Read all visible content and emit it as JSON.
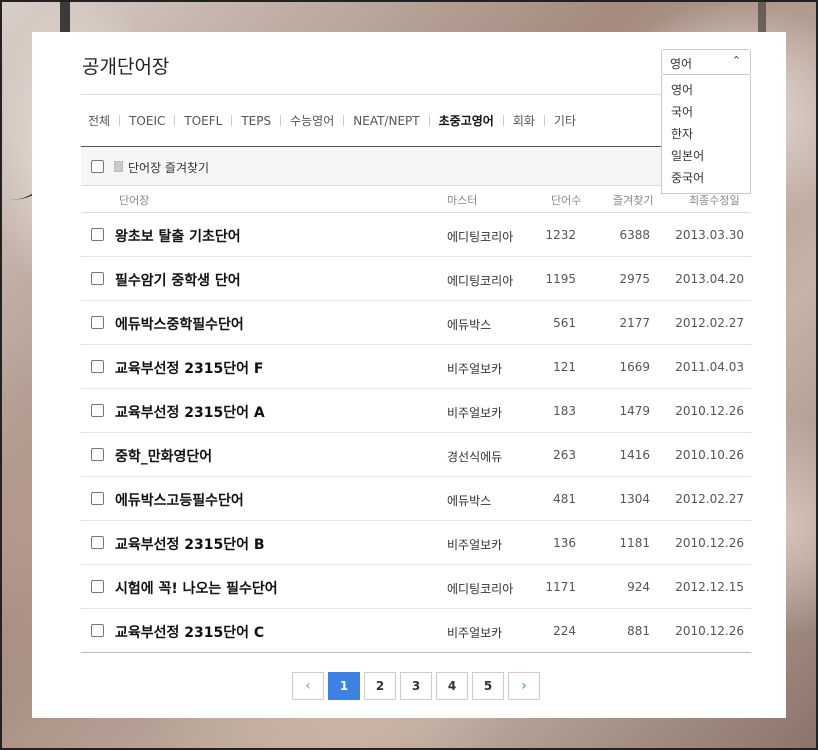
{
  "title": "공개단어장",
  "language_select": {
    "selected": "영어",
    "options": [
      "영어",
      "국어",
      "한자",
      "일본어",
      "중국어"
    ]
  },
  "tabs": [
    {
      "label": "전체"
    },
    {
      "label": "TOEIC"
    },
    {
      "label": "TOEFL"
    },
    {
      "label": "TEPS"
    },
    {
      "label": "수능영어"
    },
    {
      "label": "NEAT/NEPT"
    },
    {
      "label": "초중고영어",
      "active": true
    },
    {
      "label": "회화"
    },
    {
      "label": "기타"
    }
  ],
  "favorites_bar": {
    "label": "단어장 즐겨찾기"
  },
  "columns": {
    "name": "단어장",
    "master": "마스터",
    "count": "단어수",
    "favorites": "즐겨찾기",
    "updated": "최종수정일"
  },
  "rows": [
    {
      "name": "왕초보 탈출 기초단어",
      "master": "에디팅코리아",
      "count": "1232",
      "favorites": "6388",
      "updated": "2013.03.30"
    },
    {
      "name": "필수암기 중학생 단어",
      "master": "에디팅코리아",
      "count": "1195",
      "favorites": "2975",
      "updated": "2013.04.20"
    },
    {
      "name": "에듀박스중학필수단어",
      "master": "에듀박스",
      "count": "561",
      "favorites": "2177",
      "updated": "2012.02.27"
    },
    {
      "name": "교육부선정 2315단어 F",
      "master": "비주얼보카",
      "count": "121",
      "favorites": "1669",
      "updated": "2011.04.03"
    },
    {
      "name": "교육부선정 2315단어 A",
      "master": "비주얼보카",
      "count": "183",
      "favorites": "1479",
      "updated": "2010.12.26"
    },
    {
      "name": "중학_만화영단어",
      "master": "경선식에듀",
      "count": "263",
      "favorites": "1416",
      "updated": "2010.10.26"
    },
    {
      "name": "에듀박스고등필수단어",
      "master": "에듀박스",
      "count": "481",
      "favorites": "1304",
      "updated": "2012.02.27"
    },
    {
      "name": "교육부선정 2315단어 B",
      "master": "비주얼보카",
      "count": "136",
      "favorites": "1181",
      "updated": "2010.12.26"
    },
    {
      "name": "시험에 꼭! 나오는 필수단어",
      "master": "에디팅코리아",
      "count": "1171",
      "favorites": "924",
      "updated": "2012.12.15"
    },
    {
      "name": "교육부선정 2315단어 C",
      "master": "비주얼보카",
      "count": "224",
      "favorites": "881",
      "updated": "2010.12.26"
    }
  ],
  "pagination": {
    "prev": "‹",
    "next": "›",
    "pages": [
      "1",
      "2",
      "3",
      "4",
      "5"
    ],
    "current": "1"
  },
  "colors": {
    "accent": "#3d82e0"
  },
  "icons": {
    "select_caret": "chevron-up-icon",
    "favorites": "book-icon",
    "prev": "chevron-left-icon",
    "next": "chevron-right-icon"
  }
}
